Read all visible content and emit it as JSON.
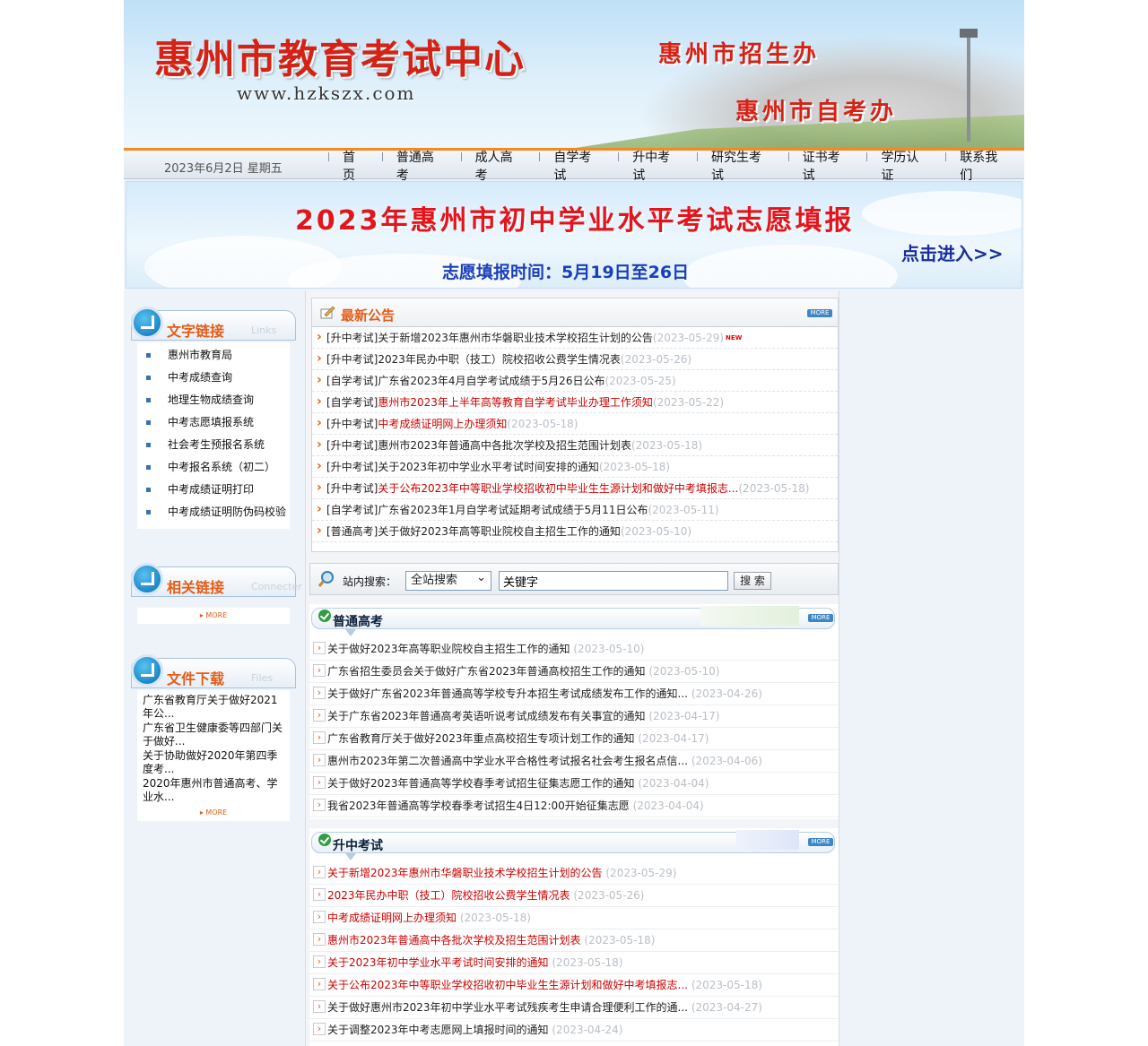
{
  "header": {
    "site_title": "惠州市教育考试中心",
    "site_url": "www.hzkszx.com",
    "sub_title_1": "惠州市招生办",
    "sub_title_2": "惠州市自考办"
  },
  "nav": {
    "date": "2023年6月2日 星期五",
    "items": [
      "首页",
      "普通高考",
      "成人高考",
      "自学考试",
      "升中考试",
      "研究生考试",
      "证书考试",
      "学历认证",
      "联系我们"
    ]
  },
  "promo": {
    "title": "2023年惠州市初中学业水平考试志愿填报",
    "link": "点击进入>>",
    "subtitle": "志愿填报时间：5月19日至26日"
  },
  "sidebar": {
    "links": {
      "title": "文字链接",
      "en": "Links",
      "items": [
        "惠州市教育局",
        "中考成绩查询",
        "地理生物成绩查询",
        "中考志愿填报系统",
        "社会考生预报名系统",
        "中考报名系统（初二）",
        "中考成绩证明打印",
        "中考成绩证明防伪码校验"
      ]
    },
    "related": {
      "title": "相关链接",
      "en": "Connecter",
      "more": "MORE"
    },
    "files": {
      "title": "文件下载",
      "en": "Files",
      "items": [
        "广东省教育厅关于做好2021年公...",
        "广东省卫生健康委等四部门关于做好...",
        "关于协助做好2020年第四季度考...",
        "2020年惠州市普通高考、学业水..."
      ],
      "more": "MORE"
    }
  },
  "notice": {
    "title": "最新公告",
    "more": "MORE",
    "new_badge": "NEW",
    "items": [
      {
        "tag": "[升中考试]",
        "text": "关于新增2023年惠州市华磐职业技术学校招生计划的公告",
        "date": "(2023-05-29)",
        "red": false
      },
      {
        "tag": "[升中考试]",
        "text": "2023年民办中职（技工）院校招收公费学生情况表",
        "date": "(2023-05-26)",
        "red": false
      },
      {
        "tag": "[自学考试]",
        "text": "广东省2023年4月自学考试成绩于5月26日公布",
        "date": "(2023-05-25)",
        "red": false
      },
      {
        "tag": "[自学考试]",
        "text": "惠州市2023年上半年高等教育自学考试毕业办理工作须知",
        "date": "(2023-05-22)",
        "red": true
      },
      {
        "tag": "[升中考试]",
        "text": "中考成绩证明网上办理须知",
        "date": "(2023-05-18)",
        "red": true
      },
      {
        "tag": "[升中考试]",
        "text": "惠州市2023年普通高中各批次学校及招生范围计划表",
        "date": "(2023-05-18)",
        "red": false
      },
      {
        "tag": "[升中考试]",
        "text": "关于2023年初中学业水平考试时间安排的通知",
        "date": "(2023-05-18)",
        "red": false
      },
      {
        "tag": "[升中考试]",
        "text": "关于公布2023年中等职业学校招收初中毕业生生源计划和做好中考填报志...",
        "date": "(2023-05-18)",
        "red": true
      },
      {
        "tag": "[自学考试]",
        "text": "广东省2023年1月自学考试延期考试成绩于5月11日公布",
        "date": "(2023-05-11)",
        "red": false
      },
      {
        "tag": "[普通高考]",
        "text": "关于做好2023年高等职业院校自主招生工作的通知",
        "date": "(2023-05-10)",
        "red": false
      }
    ]
  },
  "search": {
    "label": "站内搜索：",
    "scope": "全站搜索",
    "value": "关键字",
    "button": "搜 索"
  },
  "gaokao": {
    "title": "普通高考",
    "more": "MORE",
    "items": [
      {
        "text": "关于做好2023年高等职业院校自主招生工作的通知",
        "date": "(2023-05-10)"
      },
      {
        "text": "广东省招生委员会关于做好广东省2023年普通高校招生工作的通知",
        "date": "(2023-05-10)"
      },
      {
        "text": "关于做好广东省2023年普通高等学校专升本招生考试成绩发布工作的通知...",
        "date": "(2023-04-26)"
      },
      {
        "text": "关于广东省2023年普通高考英语听说考试成绩发布有关事宜的通知",
        "date": "(2023-04-17)"
      },
      {
        "text": "广东省教育厅关于做好2023年重点高校招生专项计划工作的通知",
        "date": "(2023-04-17)"
      },
      {
        "text": "惠州市2023年第二次普通高中学业水平合格性考试报名社会考生报名点信...",
        "date": "(2023-04-06)"
      },
      {
        "text": "关于做好2023年普通高等学校春季考试招生征集志愿工作的通知",
        "date": "(2023-04-04)"
      },
      {
        "text": "我省2023年普通高等学校春季考试招生4日12:00开始征集志愿",
        "date": "(2023-04-04)"
      }
    ]
  },
  "zhongkao": {
    "title": "升中考试",
    "more": "MORE",
    "items": [
      {
        "text": "关于新增2023年惠州市华磐职业技术学校招生计划的公告",
        "date": "(2023-05-29)",
        "red": true
      },
      {
        "text": "2023年民办中职（技工）院校招收公费学生情况表",
        "date": "(2023-05-26)",
        "red": true
      },
      {
        "text": "中考成绩证明网上办理须知",
        "date": "(2023-05-18)",
        "red": true
      },
      {
        "text": "惠州市2023年普通高中各批次学校及招生范围计划表",
        "date": "(2023-05-18)",
        "red": true
      },
      {
        "text": "关于2023年初中学业水平考试时间安排的通知",
        "date": "(2023-05-18)",
        "red": true
      },
      {
        "text": "关于公布2023年中等职业学校招收初中毕业生生源计划和做好中考填报志...",
        "date": "(2023-05-18)",
        "red": true
      },
      {
        "text": "关于做好惠州市2023年初中学业水平考试残疾考生申请合理便利工作的通...",
        "date": "(2023-04-27)",
        "red": false
      },
      {
        "text": "关于调整2023年中考志愿网上填报时间的通知",
        "date": "(2023-04-24)",
        "red": false
      }
    ]
  },
  "colors": {
    "accent": "#e35d19",
    "title_red": "#d52216",
    "link_red": "#cc0000",
    "nav_orange": "#f08a24"
  }
}
